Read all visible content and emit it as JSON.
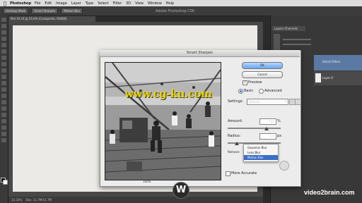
{
  "menubar": {
    "app": "Photoshop",
    "items": [
      "File",
      "Edit",
      "Image",
      "Layer",
      "Type",
      "Select",
      "Filter",
      "3D",
      "View",
      "Window",
      "Help"
    ]
  },
  "options_bar": {
    "buttons": [
      "Unsharp Mask",
      "Smart Sharpen",
      "Motion Blur"
    ],
    "title": "Adobe Photoshop CS6"
  },
  "document": {
    "tab": "Pier 01.tif @ 55.6% (Composite, RGB/8)",
    "zoom": "33.33%",
    "status_doc": "Doc: 11.7M/11.7M"
  },
  "panels": {
    "tab": "Layers  Channels",
    "layer_1": "Smart Filters",
    "layer_2": "Layer 0"
  },
  "dialog": {
    "title": "Smart Sharpen",
    "ok": "OK",
    "cancel": "Cancel",
    "preview_label": "Preview",
    "basic_label": "Basic",
    "advanced_label": "Advanced",
    "settings_label": "Settings:",
    "settings_value": "Default",
    "amount_label": "Amount:",
    "amount_value": "100",
    "amount_unit": "%",
    "radius_label": "Radius:",
    "radius_value": "1.0",
    "radius_unit": "px",
    "remove_label": "Remove:",
    "remove_options": [
      "Gaussian Blur",
      "Lens Blur",
      "Motion Blur"
    ],
    "remove_selected": "Motion Blur",
    "more_accurate_label": "More Accurate",
    "preview_zoom": "100%",
    "preview_checked": true,
    "mode_selected": "Basic"
  },
  "overlays": {
    "watermark": "www.cg-ku.com",
    "logo": "W",
    "brand": "video2brain.com"
  },
  "icons": {
    "apple": "apple-icon",
    "minus": "minus-icon",
    "plus": "plus-icon",
    "save": "save-icon",
    "trash": "trash-icon",
    "checkmark": "checkmark-icon"
  }
}
